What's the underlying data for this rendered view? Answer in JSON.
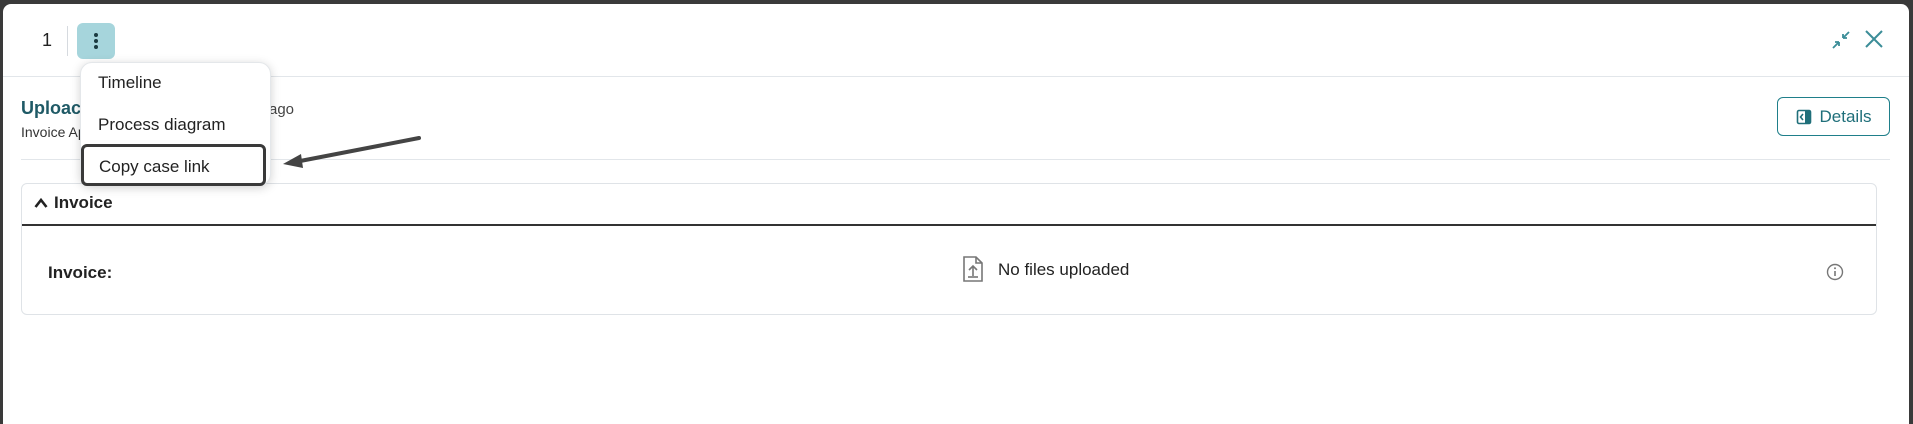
{
  "topbar": {
    "case_number": "1",
    "more_icon": "more-vertical-icon",
    "collapse_icon": "collapse-icon",
    "close_icon": "close-icon"
  },
  "menu": {
    "items": [
      {
        "label": "Timeline"
      },
      {
        "label": "Process diagram"
      },
      {
        "label": "Copy case link"
      }
    ]
  },
  "header": {
    "title": "Uploac",
    "ago": "ago",
    "subtitle": "Invoice Ap",
    "details_label": "Details"
  },
  "panel": {
    "title": "Invoice",
    "field_label": "Invoice:",
    "empty_text": "No files uploaded"
  },
  "colors": {
    "accent": "#1f7f8a",
    "kebab_bg": "#a6d5dc"
  }
}
